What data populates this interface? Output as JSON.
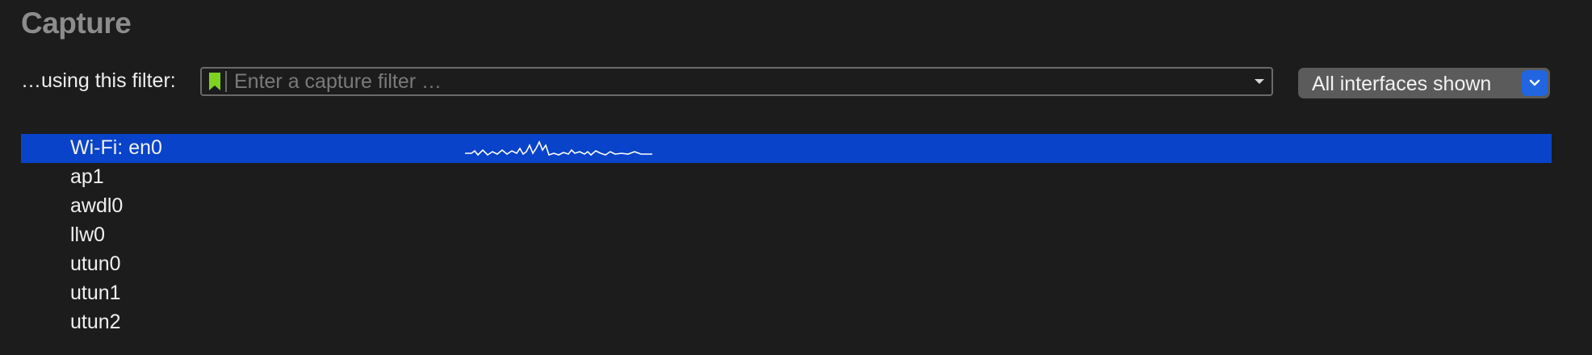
{
  "header": {
    "title": "Capture"
  },
  "filter": {
    "label": "…using this filter:",
    "placeholder": "Enter a capture filter …",
    "value": "",
    "bookmark_icon": "bookmark-icon",
    "dropdown_icon": "chevron-down-icon"
  },
  "interfaces_selector": {
    "label": "All interfaces shown",
    "icon": "chevron-down-icon",
    "accent_color": "#2265e0"
  },
  "interfaces": [
    {
      "name": "Wi-Fi: en0",
      "selected": true,
      "has_sparkline": true
    },
    {
      "name": "ap1",
      "selected": false
    },
    {
      "name": "awdl0",
      "selected": false
    },
    {
      "name": "llw0",
      "selected": false
    },
    {
      "name": "utun0",
      "selected": false
    },
    {
      "name": "utun1",
      "selected": false
    },
    {
      "name": "utun2",
      "selected": false
    }
  ],
  "colors": {
    "background": "#1c1c1c",
    "selection": "#0843c9",
    "bookmark": "#7ed321",
    "title": "#8c8c8c"
  }
}
